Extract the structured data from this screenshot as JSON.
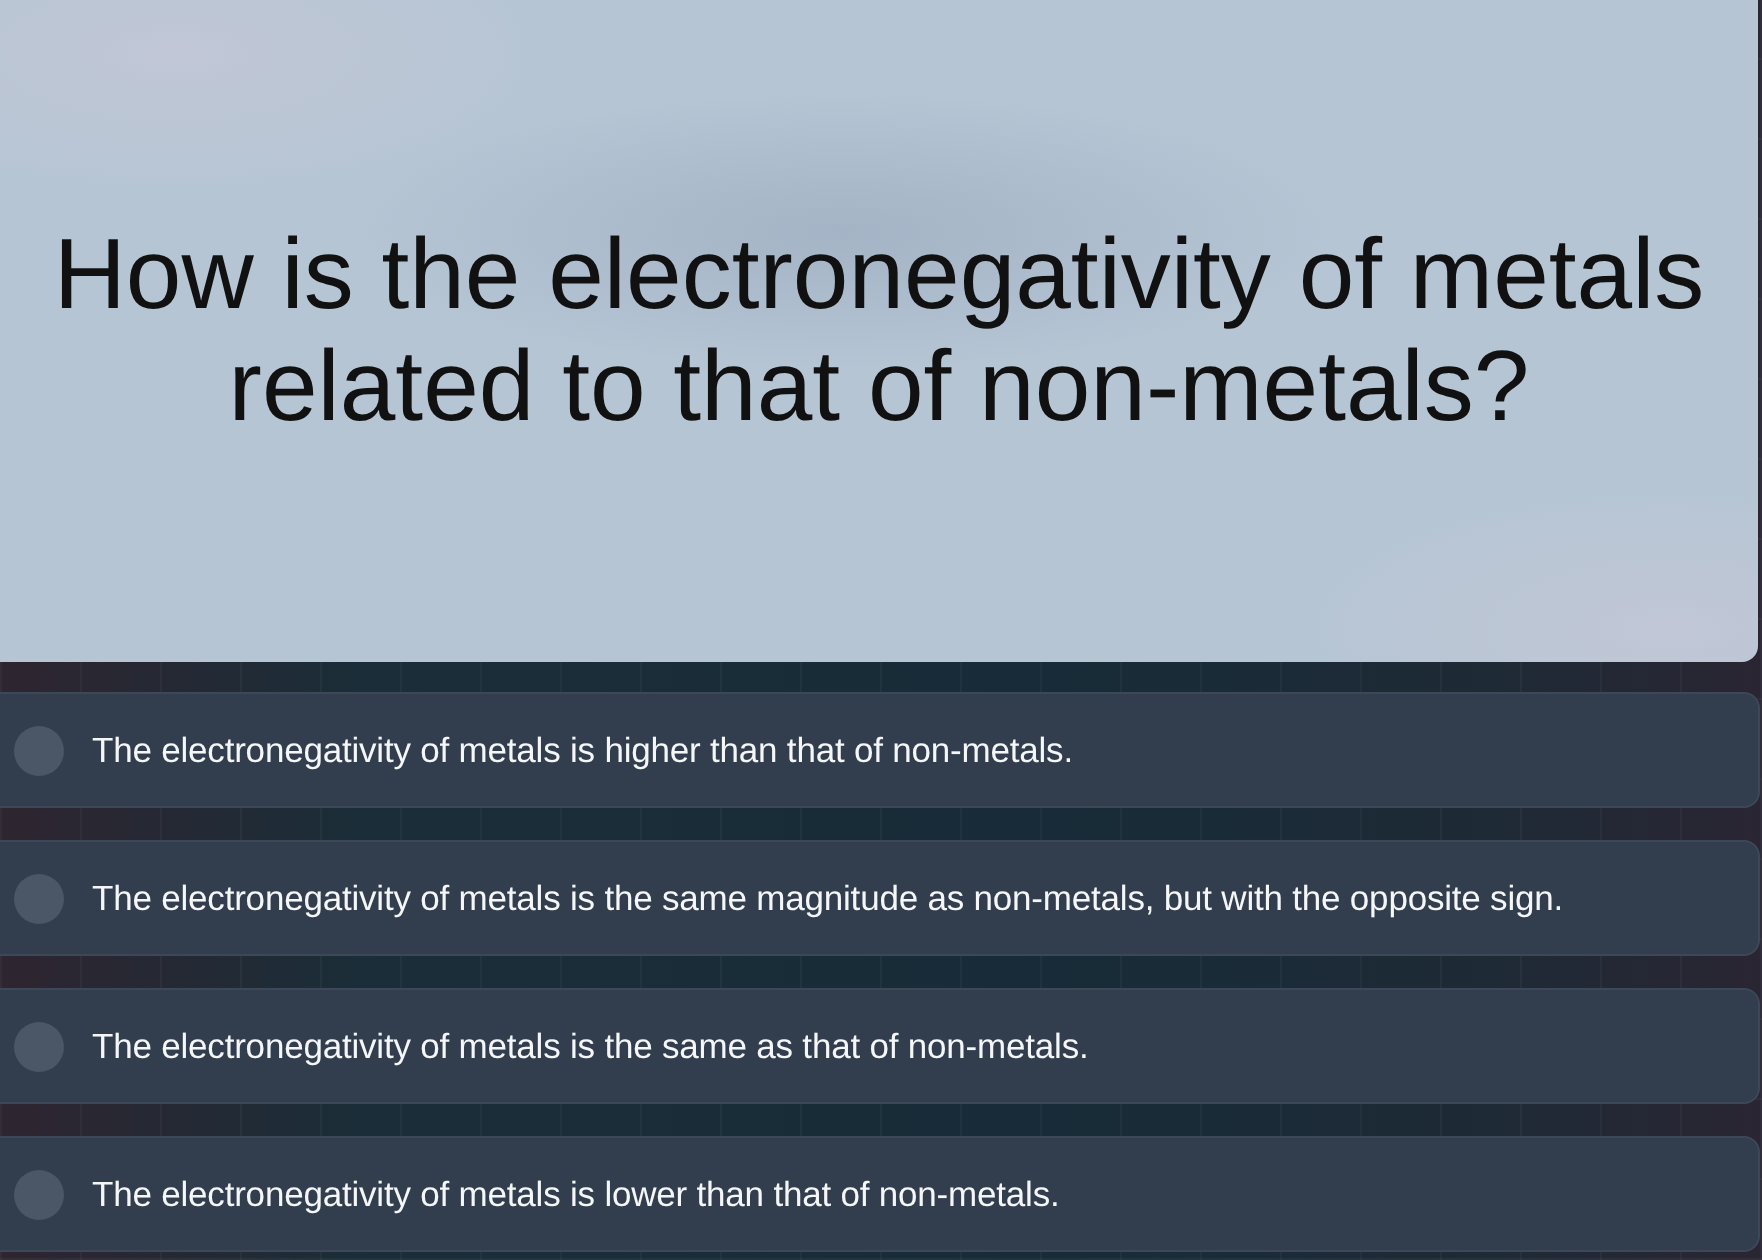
{
  "question": {
    "text": "How is the electronegativity of metals related to that of non-metals?"
  },
  "options": [
    {
      "text": "The electronegativity of metals is higher than that of non-metals.",
      "selected": false
    },
    {
      "text": "The electronegativity of metals is the same magnitude as non-metals, but with the opposite sign.",
      "selected": false
    },
    {
      "text": "The electronegativity of metals is the same as that of non-metals.",
      "selected": false
    },
    {
      "text": "The electronegativity of metals is lower than that of non-metals.",
      "selected": false
    }
  ]
}
